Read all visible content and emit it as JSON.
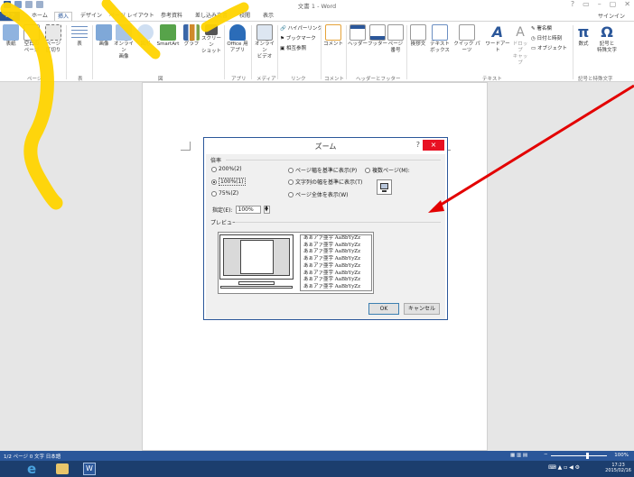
{
  "window": {
    "title": "文書 1 - Word",
    "signin": "サインイン"
  },
  "tabs": [
    "ファイル",
    "ホーム",
    "挿入",
    "デザイン",
    "ページ レイアウト",
    "参考資料",
    "差し込み文書",
    "校閲",
    "表示"
  ],
  "active_tab": "挿入",
  "ribbon": {
    "buttons": [
      {
        "label": "表紙",
        "icon": "cover-page-icon"
      },
      {
        "label": "空白の\nページ",
        "icon": "blank-page-icon"
      },
      {
        "label": "ページ\n区切り",
        "icon": "page-break-icon"
      },
      {
        "label": "表",
        "icon": "table-icon"
      },
      {
        "label": "画像",
        "icon": "picture-icon"
      },
      {
        "label": "オンライン\n画像",
        "icon": "online-picture-icon"
      },
      {
        "label": "図形",
        "icon": "shapes-icon"
      },
      {
        "label": "SmartArt",
        "icon": "smartart-icon"
      },
      {
        "label": "グラフ",
        "icon": "chart-icon"
      },
      {
        "label": "スクリーン\nショット",
        "icon": "screenshot-icon"
      },
      {
        "label": "Office 用\nアプリ",
        "icon": "apps-icon"
      },
      {
        "label": "オンライン\nビデオ",
        "icon": "online-video-icon"
      },
      {
        "label": "コメント",
        "icon": "comment-icon"
      },
      {
        "label": "ヘッダー",
        "icon": "header-icon"
      },
      {
        "label": "フッター",
        "icon": "footer-icon"
      },
      {
        "label": "ページ\n番号",
        "icon": "page-number-icon"
      },
      {
        "label": "挨拶文",
        "icon": "greeting-icon"
      },
      {
        "label": "テキスト\nボックス",
        "icon": "textbox-icon"
      },
      {
        "label": "クイック パーツ",
        "icon": "quick-parts-icon"
      },
      {
        "label": "ワードアート",
        "icon": "wordart-icon"
      },
      {
        "label": "ドロップ\nキャップ",
        "icon": "drop-cap-icon"
      },
      {
        "label": "数式",
        "icon": "equation-icon"
      },
      {
        "label": "記号と\n特殊文字",
        "icon": "symbol-icon"
      }
    ],
    "links": [
      "ハイパーリンク",
      "ブックマーク",
      "相互参照"
    ],
    "small_right": [
      "署名欄",
      "日付と時刻",
      "オブジェクト"
    ],
    "groups": [
      "ページ",
      "表",
      "図",
      "アプリ",
      "メディア",
      "リンク",
      "コメント",
      "ヘッダーとフッター",
      "テキスト",
      "記号と特殊文字"
    ]
  },
  "dialog": {
    "title": "ズーム",
    "help": "?",
    "close": "×",
    "group_zoom": "倍率",
    "options": [
      {
        "label": "200%(2)",
        "selected": false
      },
      {
        "label": "100%(1)",
        "selected": true
      },
      {
        "label": "75%(Z)",
        "selected": false
      },
      {
        "label": "ページ幅を基準に表示(P)",
        "selected": false
      },
      {
        "label": "文字列の幅を基準に表示(T)",
        "selected": false
      },
      {
        "label": "ページ全体を表示(W)",
        "selected": false
      },
      {
        "label": "複数ページ(M):",
        "selected": false
      }
    ],
    "percent_label": "指定(E):",
    "percent_value": "100%",
    "preview_label": "プレビュー",
    "sample_lines": [
      "あぁアァ亜宇 AaBbYyZz",
      "あぁアァ亜宇 AaBbYyZz",
      "あぁアァ亜宇 AaBbYyZz",
      "あぁアァ亜宇 AaBbYyZz",
      "あぁアァ亜宇 AaBbYyZz",
      "あぁアァ亜宇 AaBbYyZz",
      "あぁアァ亜宇 AaBbYyZz",
      "あぁアァ亜宇 AaBbYyZz"
    ],
    "ok": "OK",
    "cancel": "キャンセル"
  },
  "status": {
    "left": "1/2 ページ   0 文字   日本語",
    "zoom": "100%"
  },
  "taskbar": {
    "time": "17:23",
    "date": "2015/02/16"
  },
  "colors": {
    "accent": "#2b579a",
    "annotation_yellow": "#ffd400",
    "arrow_red": "#e30000"
  }
}
